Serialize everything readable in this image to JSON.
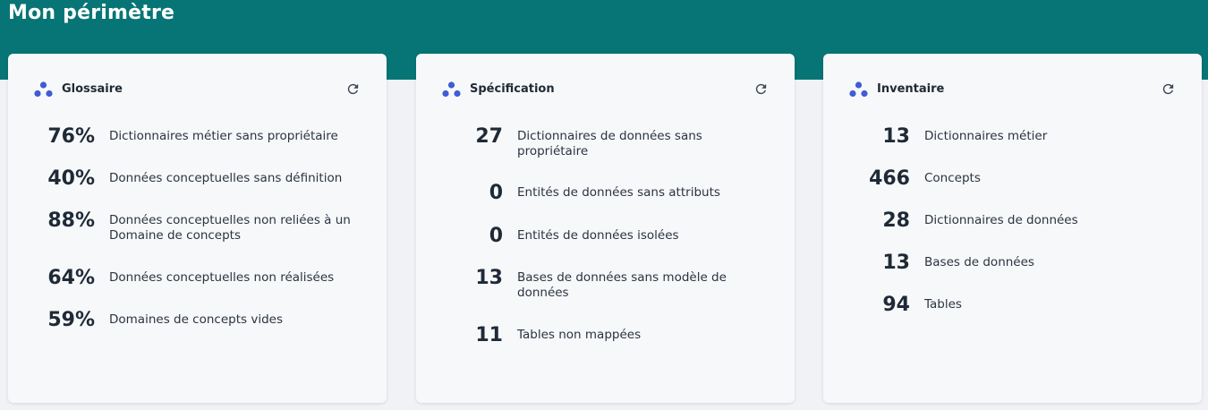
{
  "page": {
    "title": "Mon périmètre",
    "header_color": "#077575",
    "icon_color": "#3f5bd6"
  },
  "cards": [
    {
      "title": "Glossaire",
      "metrics": [
        {
          "value": "76%",
          "label": "Dictionnaires métier sans propriétaire"
        },
        {
          "value": "40%",
          "label": "Données conceptuelles sans définition"
        },
        {
          "value": "88%",
          "label": "Données conceptuelles non reliées à un Domaine de concepts"
        },
        {
          "value": "64%",
          "label": "Données conceptuelles non réalisées"
        },
        {
          "value": "59%",
          "label": "Domaines de concepts vides"
        }
      ]
    },
    {
      "title": "Spécification",
      "metrics": [
        {
          "value": "27",
          "label": "Dictionnaires de données sans propriétaire"
        },
        {
          "value": "0",
          "label": "Entités de données sans attributs"
        },
        {
          "value": "0",
          "label": "Entités de données isolées"
        },
        {
          "value": "13",
          "label": "Bases de données sans modèle de données"
        },
        {
          "value": "11",
          "label": "Tables non mappées"
        }
      ]
    },
    {
      "title": "Inventaire",
      "metrics": [
        {
          "value": "13",
          "label": "Dictionnaires métier"
        },
        {
          "value": "466",
          "label": "Concepts"
        },
        {
          "value": "28",
          "label": "Dictionnaires de données"
        },
        {
          "value": "13",
          "label": "Bases de données"
        },
        {
          "value": "94",
          "label": "Tables"
        }
      ]
    }
  ]
}
